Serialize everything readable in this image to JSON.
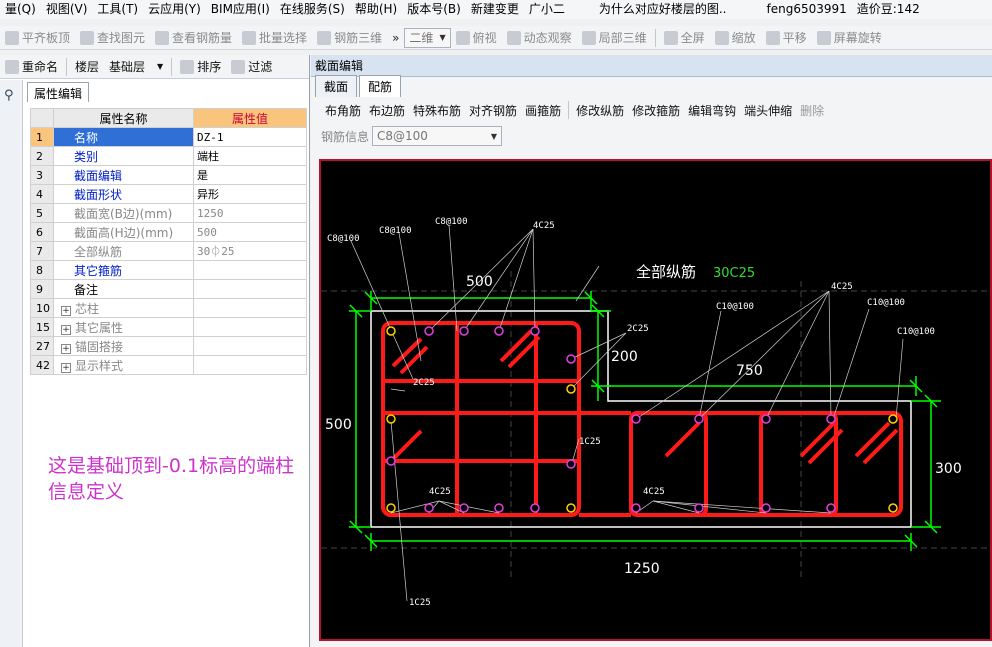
{
  "menu": {
    "items": [
      "量(Q)",
      "视图(V)",
      "工具(T)",
      "云应用(Y)",
      "BIM应用(I)",
      "在线服务(S)",
      "帮助(H)",
      "版本号(B)",
      "新建变更",
      "广小二"
    ],
    "doc_title": "为什么对应好楼层的图..",
    "user": "feng6503991",
    "cost_bean": "造价豆:142"
  },
  "toolbar": {
    "items": [
      "平齐板顶",
      "查找图元",
      "查看钢筋量",
      "批量选择",
      "钢筋三维",
      "二维",
      "俯视",
      "动态观察",
      "局部三维",
      "全屏",
      "缩放",
      "平移",
      "屏幕旋转"
    ]
  },
  "left_toolbar": {
    "rename": "重命名",
    "floor_label": "楼层",
    "floor_value": "基础层",
    "sort": "排序",
    "filter": "过滤"
  },
  "property_panel": {
    "tab": "属性编辑",
    "col_name": "属性名称",
    "col_value": "属性值",
    "rows": [
      {
        "num": "1",
        "name": "名称",
        "value": "DZ-1"
      },
      {
        "num": "2",
        "name": "类别",
        "value": "端柱"
      },
      {
        "num": "3",
        "name": "截面编辑",
        "value": "是"
      },
      {
        "num": "4",
        "name": "截面形状",
        "value": "异形"
      },
      {
        "num": "5",
        "name": "截面宽(B边)(mm)",
        "value": "1250"
      },
      {
        "num": "6",
        "name": "截面高(H边)(mm)",
        "value": "500"
      },
      {
        "num": "7",
        "name": "全部纵筋",
        "value": "30⏀25"
      },
      {
        "num": "8",
        "name": "其它箍筋",
        "value": ""
      },
      {
        "num": "9",
        "name": "备注",
        "value": ""
      },
      {
        "num": "10",
        "name": "芯柱",
        "value": ""
      },
      {
        "num": "15",
        "name": "其它属性",
        "value": ""
      },
      {
        "num": "27",
        "name": "锚固搭接",
        "value": ""
      },
      {
        "num": "42",
        "name": "显示样式",
        "value": ""
      }
    ]
  },
  "note": "这是基础顶到-0.1标高的端柱信息定义",
  "section_editor": {
    "title": "截面编辑",
    "tabs": [
      "截面",
      "配筋"
    ],
    "tools": [
      "布角筋",
      "布边筋",
      "特殊布筋",
      "对齐钢筋",
      "画箍筋",
      "修改纵筋",
      "修改箍筋",
      "编辑弯钩",
      "端头伸缩",
      "删除"
    ],
    "rebar_info_label": "钢筋信息",
    "rebar_info_value": "C8@100"
  },
  "drawing": {
    "dims": {
      "width_top": "500",
      "step": "200",
      "step_w": "750",
      "left_h": "500",
      "right_h": "300",
      "total": "1250"
    },
    "all_long_label": "全部纵筋",
    "all_long_value": "30C25",
    "labels": {
      "c8_a": "C8@100",
      "c8_b": "C8@100",
      "c8_c": "C8@100",
      "four_c25_top": "4C25",
      "two_c25_right": "2C25",
      "two_c25_left": "2C25",
      "one_c25_mid": "1C25",
      "four_c25_bl": "4C25",
      "four_c25_bm": "4C25",
      "one_c25_bottom": "1C25",
      "c10_a": "C10@100",
      "c10_b": "C10@100",
      "c10_c": "C10@100",
      "four_c25_tr": "4C25"
    }
  }
}
